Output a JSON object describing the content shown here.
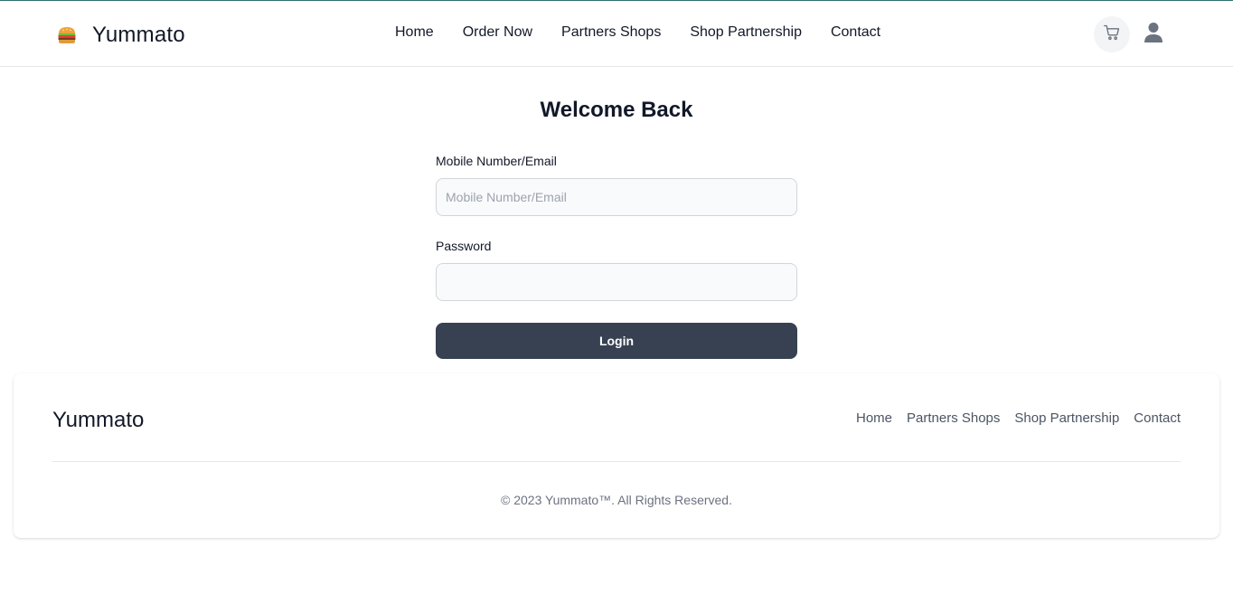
{
  "brand": {
    "name": "Yummato",
    "logo_icon": "burger-icon"
  },
  "nav": {
    "items": [
      {
        "label": "Home"
      },
      {
        "label": "Order Now"
      },
      {
        "label": "Partners Shops"
      },
      {
        "label": "Shop Partnership"
      },
      {
        "label": "Contact"
      }
    ]
  },
  "header_actions": {
    "cart_icon": "shopping-cart-icon",
    "user_icon": "user-icon"
  },
  "login": {
    "title": "Welcome Back",
    "identifier_label": "Mobile Number/Email",
    "identifier_placeholder": "Mobile Number/Email",
    "identifier_value": "",
    "password_label": "Password",
    "password_value": "",
    "submit_label": "Login"
  },
  "footer": {
    "brand": "Yummato",
    "links": [
      {
        "label": "Home"
      },
      {
        "label": "Partners Shops"
      },
      {
        "label": "Shop Partnership"
      },
      {
        "label": "Contact"
      }
    ],
    "copyright": "© 2023 Yummato™. All Rights Reserved."
  },
  "colors": {
    "accent_line": "#2f6f73",
    "button_bg": "#374151",
    "input_bg": "#f9fafb",
    "cart_bg": "#f3f4f6"
  }
}
